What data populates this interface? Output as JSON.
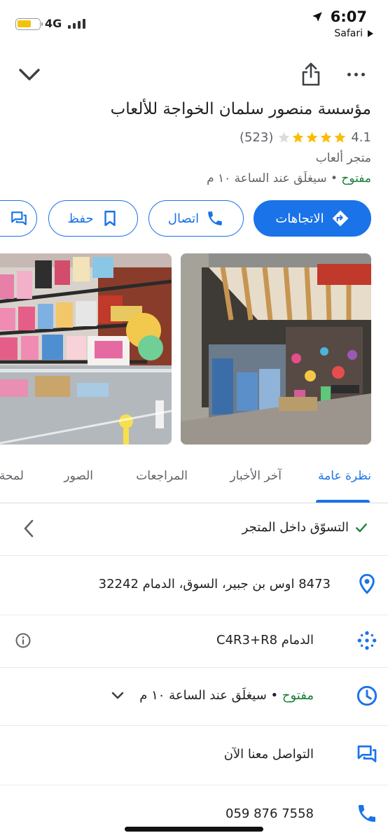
{
  "status_bar": {
    "network": "4G",
    "time": "6:07",
    "back_app": "Safari",
    "battery_level": 0.4
  },
  "place": {
    "name": "مؤسسة منصور سلمان الخواجة للألعاب",
    "rating": "4.1",
    "review_count": "(523)",
    "star_fill": 4,
    "category": "متجر ألعاب",
    "open_status": "مفتوح",
    "separator": " • ",
    "closing_text": "سيغلَق عند الساعة ١٠ م"
  },
  "actions": {
    "directions": "الاتجاهات",
    "call": "اتصال",
    "save": "حفظ"
  },
  "tabs": [
    "نظرة عامة",
    "آخر الأخبار",
    "المراجعات",
    "الصور",
    "لمحة"
  ],
  "details": {
    "in_store": "التسوّق داخل المتجر",
    "address": "8473 اوس بن جبير، السوق، الدمام 32242",
    "plus_code": "الدمام C4R3+R8",
    "hours_open": "مفتوح",
    "hours_separator": " • ",
    "hours_close": "سيغلَق عند الساعة ١٠ م",
    "chat": "التواصل معنا الآن",
    "phone": "059 876 7558"
  },
  "icons": {
    "back": "chevron-down-icon",
    "share": "share-icon",
    "more": "more-horiz-icon",
    "directions": "directions-icon",
    "call": "phone-icon",
    "save": "bookmark-icon",
    "message": "message-icon",
    "check": "check-icon",
    "pin": "location-pin-icon",
    "plus_code": "plus-code-icon",
    "info": "info-icon",
    "clock": "clock-icon",
    "expand": "chevron-down-icon"
  },
  "colors": {
    "accent": "#1a73e8",
    "open": "#188038",
    "star": "#fbbc04",
    "text": "#202124",
    "secondary": "#5f6368"
  }
}
